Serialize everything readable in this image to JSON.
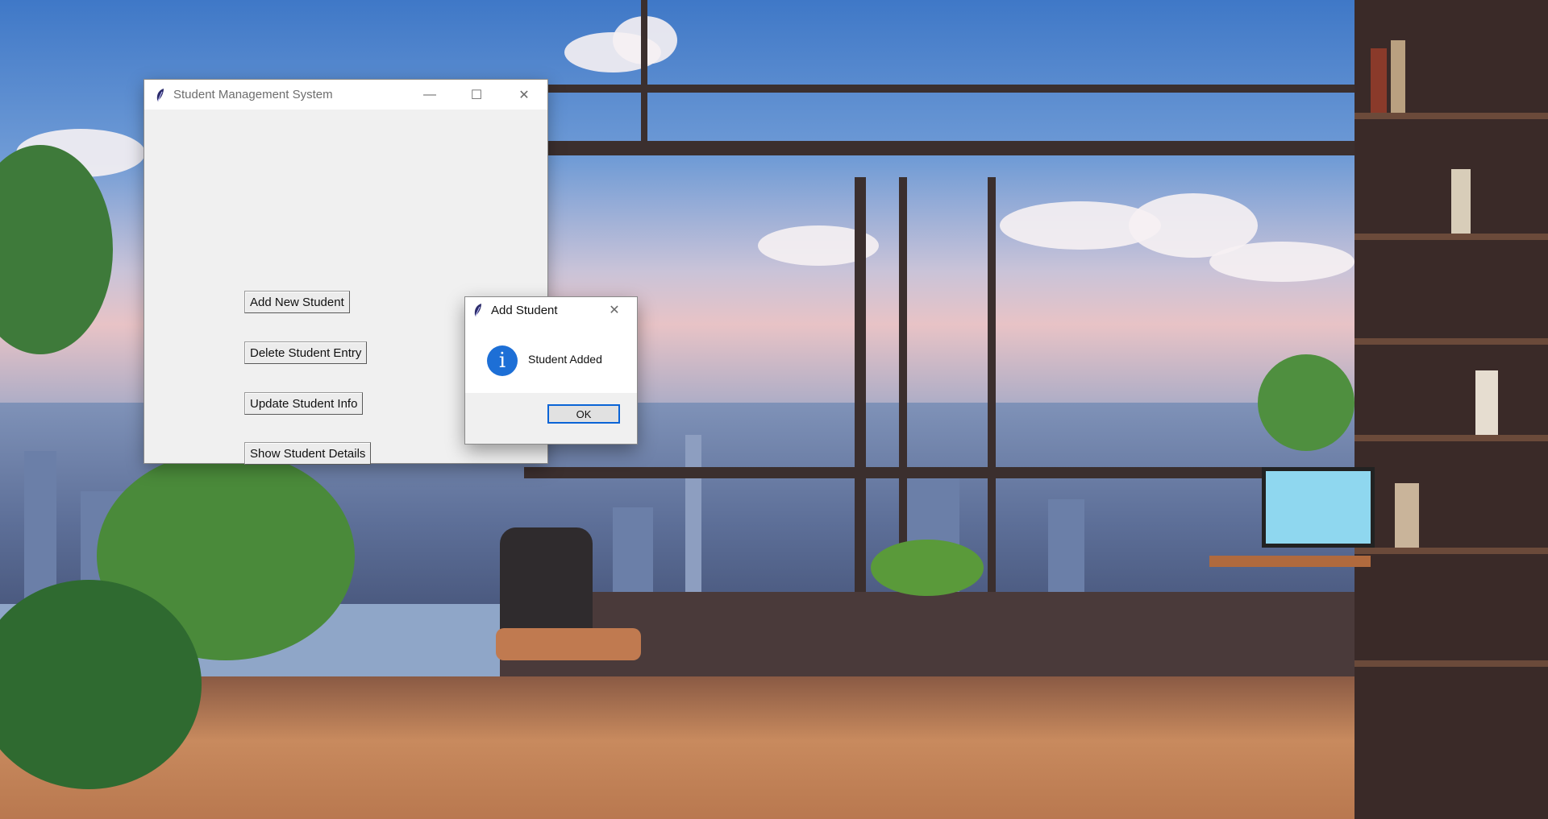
{
  "main_window": {
    "title": "Student Management System",
    "controls": {
      "minimize": "—",
      "maximize": "☐",
      "close": "✕"
    },
    "buttons": {
      "add": "Add New Student",
      "delete": "Delete Student Entry",
      "update": "Update Student Info",
      "show": "Show Student Details"
    }
  },
  "dialog": {
    "title": "Add Student",
    "close": "✕",
    "icon": "info-icon",
    "icon_glyph": "i",
    "message": "Student Added",
    "ok_label": "OK"
  },
  "colors": {
    "dialog_focus_border": "#0a64d6",
    "info_icon": "#1d6fd6",
    "window_bg": "#f0f0f0"
  }
}
